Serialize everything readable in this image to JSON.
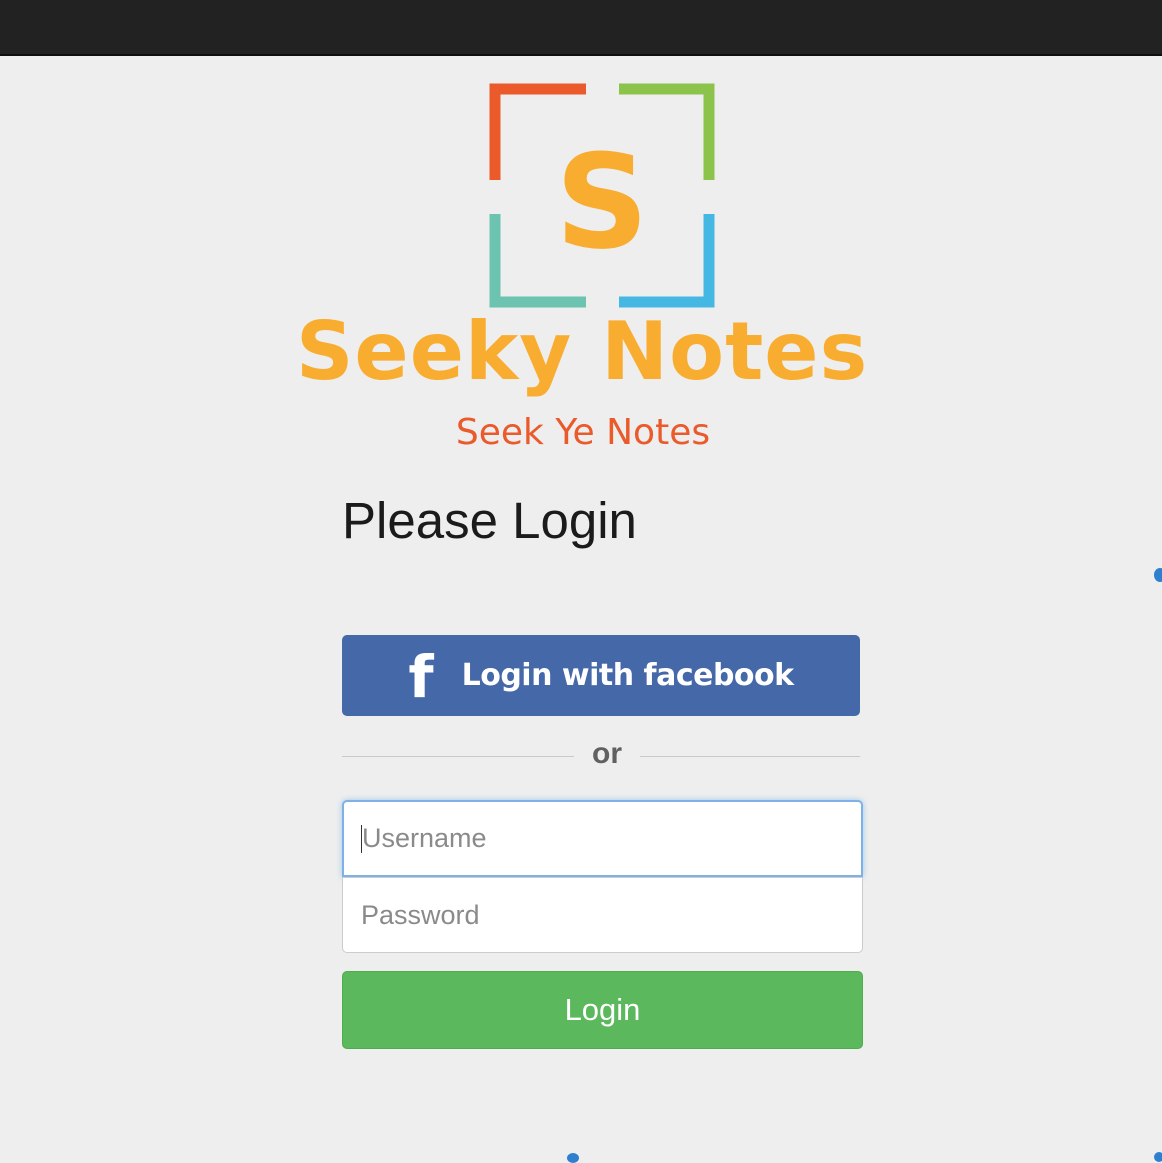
{
  "brand": {
    "name": "Seeky Notes",
    "tagline": "Seek Ye Notes",
    "logo_letter": "S",
    "colors": {
      "orange_red": "#ea5a2b",
      "green": "#8cc34b",
      "teal": "#6cc3b0",
      "blue": "#45b7e3",
      "yellow": "#f9ad30"
    }
  },
  "page": {
    "title": "Please Login"
  },
  "facebook": {
    "icon": "facebook-f-icon",
    "icon_glyph": "f",
    "label": "Login with facebook",
    "color": "#4568a9"
  },
  "divider": {
    "text": "or"
  },
  "form": {
    "username_placeholder": "Username",
    "password_placeholder": "Password",
    "login_label": "Login",
    "login_color": "#5cb85c"
  }
}
